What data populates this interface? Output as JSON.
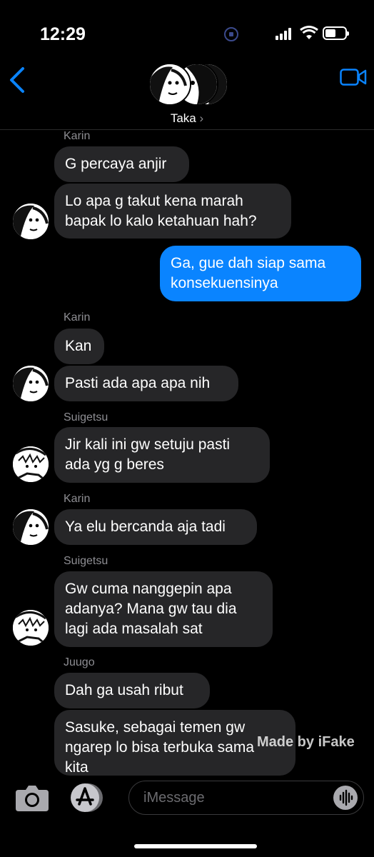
{
  "status": {
    "time": "12:29"
  },
  "header": {
    "group_name": "Taka",
    "chevron": "›"
  },
  "messages": [
    {
      "sender": "Karin",
      "text": "G percaya anjir"
    },
    {
      "text": "Lo apa g takut kena marah\nbapak lo kalo ketahuan hah?"
    },
    {
      "text": "Ga, gue dah siap sama\nkonsekuensinya",
      "outgoing": true
    },
    {
      "sender": "Karin",
      "text": "Kan"
    },
    {
      "text": "Pasti ada apa apa nih"
    },
    {
      "sender": "Suigetsu",
      "text": "Jir kali ini gw setuju pasti\nada yg g beres"
    },
    {
      "sender": "Karin",
      "text": "Ya elu bercanda aja tadi"
    },
    {
      "sender": "Suigetsu",
      "text": "Gw cuma nanggepin apa\nadanya? Mana gw tau dia\nlagi ada masalah sat"
    },
    {
      "sender": "Juugo",
      "text": "Dah ga usah ribut"
    },
    {
      "text": "Sasuke, sebagai temen gw\nngarep lo bisa terbuka sama\nkita"
    }
  ],
  "composer": {
    "placeholder": "iMessage"
  },
  "watermark": "Made by iFake",
  "colors": {
    "outgoing": "#0a84ff",
    "incoming": "#262628",
    "accent": "#0a84ff"
  },
  "icons": [
    "back-chevron-icon",
    "video-camera-icon",
    "camera-icon",
    "app-store-icon",
    "audio-waveform-icon"
  ]
}
